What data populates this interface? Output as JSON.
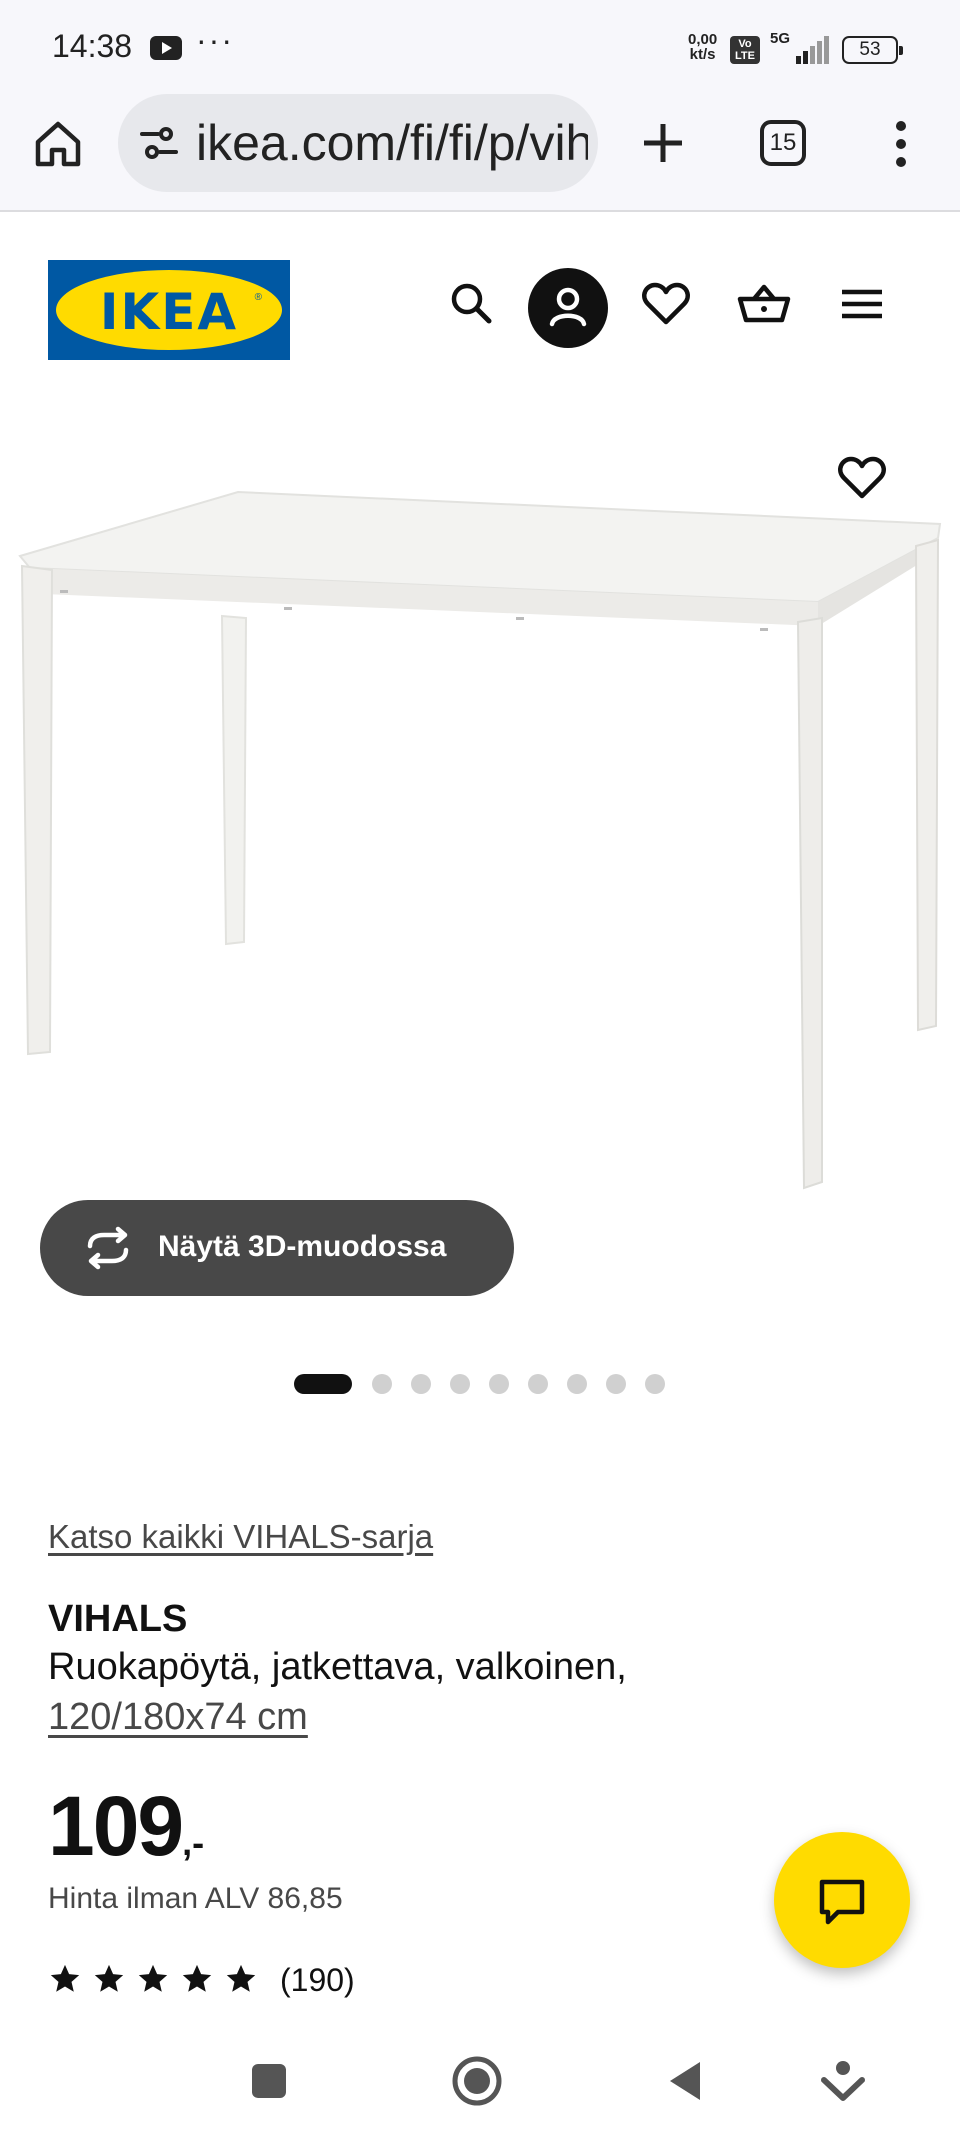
{
  "status_bar": {
    "time": "14:38",
    "more": "···",
    "net_speed_value": "0,00",
    "net_speed_unit": "kt/s",
    "volte": "Vo LTE",
    "network": "5G",
    "battery": "53"
  },
  "browser": {
    "url": "ikea.com/fi/fi/p/vihals",
    "tab_count": "15"
  },
  "header": {
    "logo_text": "IKEA"
  },
  "product_image": {
    "view_3d_label": "Näytä 3D-muodossa",
    "slide_count": 9,
    "active_slide": 1
  },
  "product": {
    "series_link": "Katso kaikki VIHALS-sarja",
    "name": "VIHALS",
    "description": "Ruokapöytä, jatkettava, valkoinen,",
    "size": "120/180x74 cm",
    "price_integer": "109",
    "price_decimal": ",-",
    "price_without_vat": "Hinta ilman ALV 86,85",
    "rating_stars": 5,
    "review_count": "(190)"
  },
  "colors": {
    "ikea_blue": "#0058a3",
    "ikea_yellow": "#ffdb00",
    "dark_button": "#484848"
  }
}
